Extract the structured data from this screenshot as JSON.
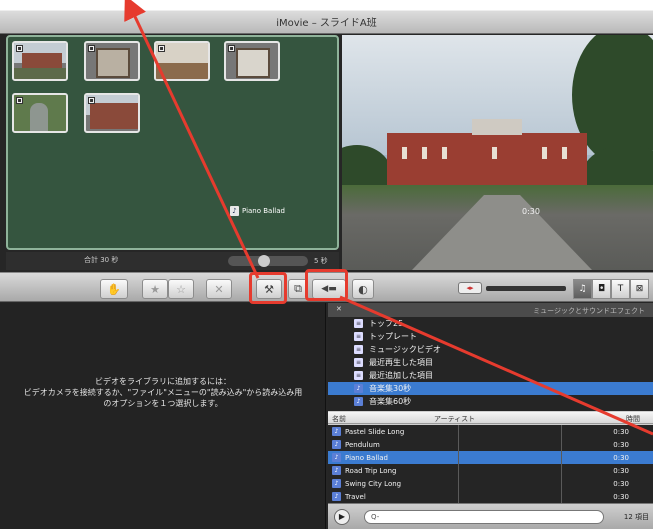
{
  "window": {
    "title": "iMovie – スライドA班"
  },
  "project": {
    "music_label": "Piano Ballad",
    "total_label": "合計 30 秒",
    "slider_value": "5 秒"
  },
  "viewer": {
    "timecode": "0:30"
  },
  "toolbar": {
    "buttons": [
      {
        "name": "hand",
        "glyph": "✋"
      },
      {
        "name": "star",
        "glyph": "★"
      },
      {
        "name": "star-empty",
        "glyph": "☆"
      },
      {
        "name": "reject",
        "glyph": "✕"
      },
      {
        "name": "tool",
        "glyph": "⚒"
      },
      {
        "name": "crop",
        "glyph": "⧉"
      },
      {
        "name": "audio",
        "glyph": "◀▬"
      },
      {
        "name": "color",
        "glyph": "◐"
      }
    ],
    "segments": [
      "♫",
      "◘",
      "T",
      "⊠"
    ]
  },
  "events": {
    "message_line1": "ビデオをライブラリに追加するには：",
    "message_line2": "ビデオカメラを接続するか、\"ファイル\"メニューの\"読み込み\"から読み込み用",
    "message_line3": "のオプションを１つ選択します。"
  },
  "browser": {
    "header_title": "ミュージックとサウンドエフェクト",
    "sources": [
      {
        "label": "トップ25",
        "icon": "list"
      },
      {
        "label": "トップレート",
        "icon": "list"
      },
      {
        "label": "ミュージックビデオ",
        "icon": "list"
      },
      {
        "label": "最近再生した項目",
        "icon": "list"
      },
      {
        "label": "最近追加した項目",
        "icon": "list"
      },
      {
        "label": "音楽集30秒",
        "icon": "music",
        "selected": true
      },
      {
        "label": "音楽集60秒",
        "icon": "music"
      }
    ],
    "columns": {
      "name": "名前",
      "artist": "アーティスト",
      "time": "時間"
    },
    "tracks": [
      {
        "name": "Pastel Slide Long",
        "time": "0:30"
      },
      {
        "name": "Pendulum",
        "time": "0:30"
      },
      {
        "name": "Piano Ballad",
        "time": "0:30",
        "selected": true
      },
      {
        "name": "Road Trip Long",
        "time": "0:30"
      },
      {
        "name": "Swing City Long",
        "time": "0:30"
      },
      {
        "name": "Travel",
        "time": "0:30"
      }
    ],
    "search_placeholder": "Q-",
    "item_count": "12 項目"
  },
  "colors": {
    "highlight": "#e63b2e",
    "selection": "#3b7bd0",
    "project_bg": "#35553f"
  }
}
